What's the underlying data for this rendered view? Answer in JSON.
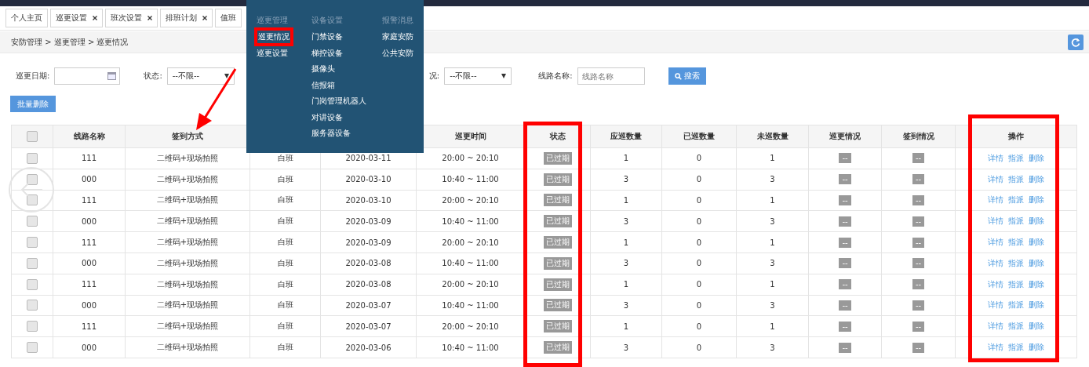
{
  "tabs": [
    {
      "label": "个人主页",
      "closable": false,
      "selected": false
    },
    {
      "label": "巡更设置",
      "closable": true,
      "selected": false
    },
    {
      "label": "班次设置",
      "closable": true,
      "selected": false
    },
    {
      "label": "排班计划",
      "closable": true,
      "selected": false
    },
    {
      "label": "值班",
      "closable": false,
      "selected": false
    }
  ],
  "breadcrumb": "安防管理 > 巡更管理 > 巡更情况",
  "filters": {
    "date_label": "巡更日期:",
    "status_label": "状态:",
    "status_value": "--不限--",
    "label_3": "况:",
    "value_3": "--不限--",
    "route_label": "线路名称:",
    "route_placeholder": "线路名称",
    "search_button": "搜索"
  },
  "batch_delete_button": "批量删除",
  "table": {
    "all_checked": false,
    "columns": [
      "线路名称",
      "签到方式",
      "",
      "",
      "巡更时间",
      "状态",
      "应巡数量",
      "已巡数量",
      "未巡数量",
      "巡更情况",
      "签到情况",
      "操作"
    ],
    "rows": [
      {
        "checked": false,
        "cells": [
          "111",
          "二维码+现场拍照",
          "白班",
          "2020-03-11",
          "20:00 ~ 20:10",
          "已过期",
          "1",
          "0",
          "1",
          "--",
          "--"
        ],
        "actions": [
          "详情",
          "指派",
          "删除"
        ]
      },
      {
        "checked": false,
        "cells": [
          "000",
          "二维码+现场拍照",
          "白班",
          "2020-03-10",
          "10:40 ~ 11:00",
          "已过期",
          "3",
          "0",
          "3",
          "--",
          "--"
        ],
        "actions": [
          "详情",
          "指派",
          "删除"
        ]
      },
      {
        "checked": false,
        "cells": [
          "111",
          "二维码+现场拍照",
          "白班",
          "2020-03-10",
          "20:00 ~ 20:10",
          "已过期",
          "1",
          "0",
          "1",
          "--",
          "--"
        ],
        "actions": [
          "详情",
          "指派",
          "删除"
        ]
      },
      {
        "checked": false,
        "cells": [
          "000",
          "二维码+现场拍照",
          "白班",
          "2020-03-09",
          "10:40 ~ 11:00",
          "已过期",
          "3",
          "0",
          "3",
          "--",
          "--"
        ],
        "actions": [
          "详情",
          "指派",
          "删除"
        ]
      },
      {
        "checked": false,
        "cells": [
          "111",
          "二维码+现场拍照",
          "白班",
          "2020-03-09",
          "20:00 ~ 20:10",
          "已过期",
          "1",
          "0",
          "1",
          "--",
          "--"
        ],
        "actions": [
          "详情",
          "指派",
          "删除"
        ]
      },
      {
        "checked": false,
        "cells": [
          "000",
          "二维码+现场拍照",
          "白班",
          "2020-03-08",
          "10:40 ~ 11:00",
          "已过期",
          "3",
          "0",
          "3",
          "--",
          "--"
        ],
        "actions": [
          "详情",
          "指派",
          "删除"
        ]
      },
      {
        "checked": false,
        "cells": [
          "111",
          "二维码+现场拍照",
          "白班",
          "2020-03-08",
          "20:00 ~ 20:10",
          "已过期",
          "1",
          "0",
          "1",
          "--",
          "--"
        ],
        "actions": [
          "详情",
          "指派",
          "删除"
        ]
      },
      {
        "checked": false,
        "cells": [
          "000",
          "二维码+现场拍照",
          "白班",
          "2020-03-07",
          "10:40 ~ 11:00",
          "已过期",
          "3",
          "0",
          "3",
          "--",
          "--"
        ],
        "actions": [
          "详情",
          "指派",
          "删除"
        ]
      },
      {
        "checked": false,
        "cells": [
          "111",
          "二维码+现场拍照",
          "白班",
          "2020-03-07",
          "20:00 ~ 20:10",
          "已过期",
          "1",
          "0",
          "1",
          "--",
          "--"
        ],
        "actions": [
          "详情",
          "指派",
          "删除"
        ]
      },
      {
        "checked": false,
        "cells": [
          "000",
          "二维码+现场拍照",
          "白班",
          "2020-03-06",
          "10:40 ~ 11:00",
          "已过期",
          "3",
          "0",
          "3",
          "--",
          "--"
        ],
        "actions": [
          "详情",
          "指派",
          "删除"
        ]
      }
    ]
  },
  "menu": {
    "columns": [
      {
        "heading": "巡更管理",
        "items": [
          {
            "label": "巡更情况",
            "selected": true
          },
          {
            "label": "巡更设置",
            "selected": false
          }
        ]
      },
      {
        "heading": "设备设置",
        "items": [
          {
            "label": "门禁设备",
            "selected": false
          },
          {
            "label": "梯控设备",
            "selected": false
          },
          {
            "label": "摄像头",
            "selected": false
          },
          {
            "label": "信报箱",
            "selected": false
          },
          {
            "label": "门岗管理机器人",
            "selected": false
          },
          {
            "label": "对讲设备",
            "selected": false
          },
          {
            "label": "服务器设备",
            "selected": false
          }
        ]
      },
      {
        "heading": "报警消息",
        "items": [
          {
            "label": "家庭安防",
            "selected": false
          },
          {
            "label": "公共安防",
            "selected": false
          }
        ]
      }
    ]
  }
}
